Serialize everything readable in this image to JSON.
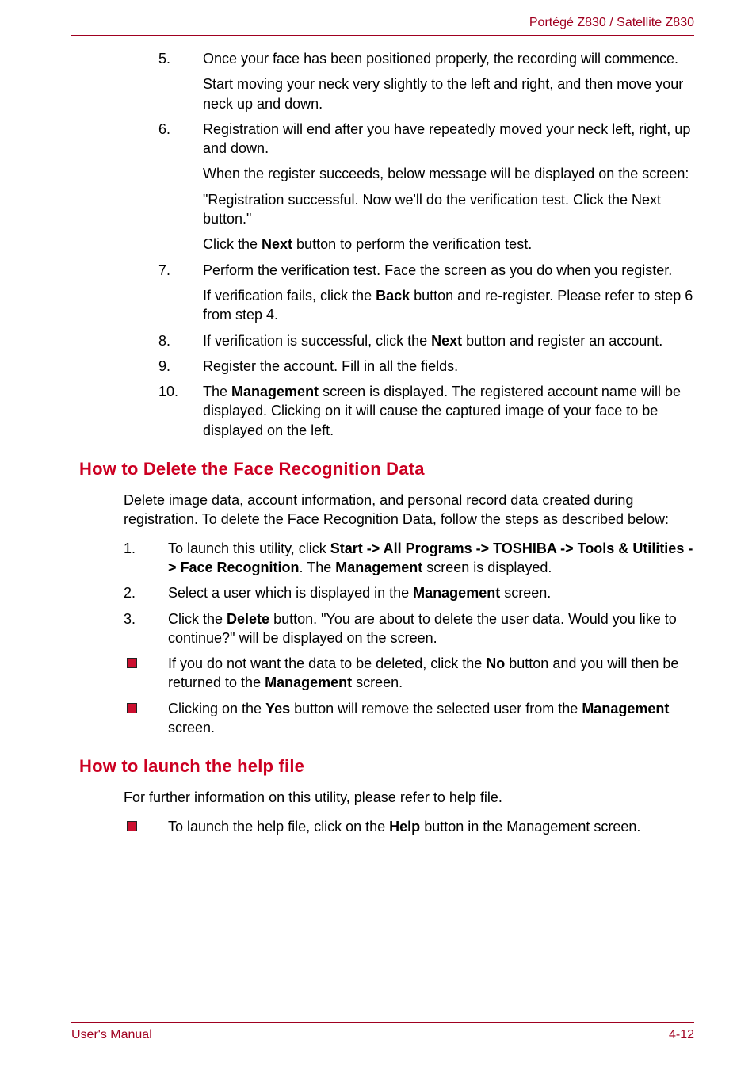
{
  "header": {
    "title": "Portégé Z830 / Satellite Z830"
  },
  "footer": {
    "left": "User's Manual",
    "right": "4-12"
  },
  "top_list": [
    {
      "n": "5.",
      "paras": [
        "Once your face has been positioned properly, the recording will commence.",
        "Start moving your neck very slightly to the left and right, and then move your neck up and down."
      ]
    },
    {
      "n": "6.",
      "paras": [
        "Registration will end after you have repeatedly moved your neck left, right, up and down.",
        "When the register succeeds, below message will be displayed on the screen:",
        "\"Registration successful. Now we'll do the verification test. Click the Next button.\""
      ],
      "last_html": {
        "pre": "Click the ",
        "b1": "Next",
        "post": " button to perform the verification test."
      }
    },
    {
      "n": "7.",
      "paras": [
        "Perform the verification test. Face the screen as you do when you register."
      ],
      "last_html": {
        "pre": "If verification fails, click the ",
        "b1": "Back",
        "post": " button and re-register. Please refer to step 6 from step 4."
      }
    },
    {
      "n": "8.",
      "last_html": {
        "pre": "If verification is successful, click the ",
        "b1": "Next",
        "post": " button and register an account."
      }
    },
    {
      "n": "9.",
      "paras": [
        "Register the account. Fill in all the fields."
      ]
    },
    {
      "n": "10.",
      "last_html": {
        "pre": "The ",
        "b1": "Management",
        "post": " screen is displayed. The registered account name will be displayed. Clicking on it will cause the captured image of your face to be displayed on the left."
      }
    }
  ],
  "sect1": {
    "title": "How to Delete the Face Recognition Data",
    "intro": "Delete image data, account information, and personal record data created during registration. To delete the Face Recognition Data, follow the steps as described below:",
    "ol": [
      {
        "n": "1.",
        "html": {
          "pre": "To launch this utility, click ",
          "b1": "Start -> All Programs -> TOSHIBA -> Tools & Utilities -> Face Recognition",
          "mid1": ". The ",
          "b2": "Management",
          "post": " screen is displayed."
        }
      },
      {
        "n": "2.",
        "html": {
          "pre": "Select a user which is displayed in the ",
          "b1": "Management",
          "post": " screen."
        }
      },
      {
        "n": "3.",
        "html": {
          "pre": "Click the ",
          "b1": "Delete",
          "post": " button. \"You are about to delete the user data. Would you like to continue?\" will be displayed on the screen."
        }
      }
    ],
    "ul": [
      {
        "html": {
          "pre": "If you do not want the data to be deleted, click the ",
          "b1": "No",
          "mid1": " button and you will then be returned to the ",
          "b2": "Management",
          "post": " screen."
        }
      },
      {
        "html": {
          "pre": "Clicking on the ",
          "b1": "Yes",
          "mid1": " button will remove the selected user from the ",
          "b2": "Management",
          "post": " screen."
        }
      }
    ]
  },
  "sect2": {
    "title": "How to launch the help file",
    "intro": "For further information on this utility, please refer to help file.",
    "ul": [
      {
        "html": {
          "pre": "To launch the help file, click on the ",
          "b1": "Help",
          "post": " button in the Management screen."
        }
      }
    ]
  }
}
